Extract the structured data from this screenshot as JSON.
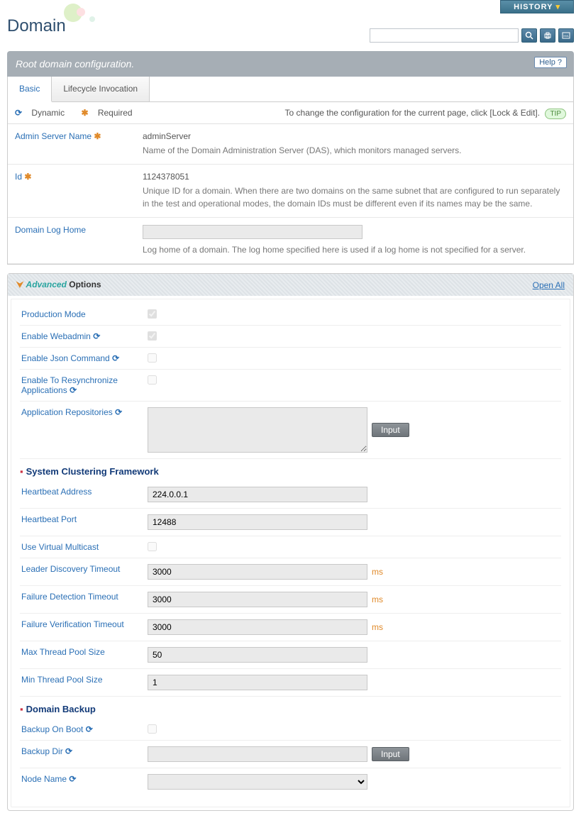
{
  "header": {
    "history_label": "HISTORY",
    "page_title": "Domain",
    "search_placeholder": ""
  },
  "banner": {
    "subtitle": "Root domain configuration.",
    "help_label": "Help"
  },
  "tabs": [
    {
      "label": "Basic",
      "active": true
    },
    {
      "label": "Lifecycle Invocation",
      "active": false
    }
  ],
  "legend": {
    "dynamic": "Dynamic",
    "required": "Required",
    "hint": "To change the configuration for the current page, click [Lock & Edit].",
    "tip": "TIP"
  },
  "basic_fields": {
    "admin_server_name": {
      "label": "Admin Server Name",
      "value": "adminServer",
      "desc": "Name of the Domain Administration Server (DAS), which monitors managed servers."
    },
    "id": {
      "label": "Id",
      "value": "1124378051",
      "desc": "Unique ID for a domain. When there are two domains on the same subnet that are configured to run separately in the test and operational modes, the domain IDs must be different even if its names may be the same."
    },
    "domain_log_home": {
      "label": "Domain Log Home",
      "value": "",
      "desc": "Log home of a domain. The log home specified here is used if a log home is not specified for a server."
    }
  },
  "advanced": {
    "title_adv": "Advanced",
    "title_opt": "Options",
    "open_all": "Open All",
    "input_btn": "Input",
    "fields": {
      "production_mode": {
        "label": "Production Mode",
        "checked": true,
        "dynamic": false
      },
      "enable_webadmin": {
        "label": "Enable Webadmin",
        "checked": true,
        "dynamic": true
      },
      "enable_json_command": {
        "label": "Enable Json Command",
        "checked": false,
        "dynamic": true
      },
      "enable_resync": {
        "label": "Enable To Resynchronize Applications",
        "checked": false,
        "dynamic": true
      },
      "app_repos": {
        "label": "Application Repositories",
        "value": "",
        "dynamic": true
      }
    },
    "sections": {
      "scf": {
        "title": "System Clustering Framework",
        "heartbeat_address": {
          "label": "Heartbeat Address",
          "value": "224.0.0.1"
        },
        "heartbeat_port": {
          "label": "Heartbeat Port",
          "value": "12488"
        },
        "use_virtual_multicast": {
          "label": "Use Virtual Multicast",
          "checked": false
        },
        "leader_discovery_timeout": {
          "label": "Leader Discovery Timeout",
          "value": "3000",
          "unit": "ms"
        },
        "failure_detection_timeout": {
          "label": "Failure Detection Timeout",
          "value": "3000",
          "unit": "ms"
        },
        "failure_verification_timeout": {
          "label": "Failure Verification Timeout",
          "value": "3000",
          "unit": "ms"
        },
        "max_thread_pool": {
          "label": "Max Thread Pool Size",
          "value": "50"
        },
        "min_thread_pool": {
          "label": "Min Thread Pool Size",
          "value": "1"
        }
      },
      "backup": {
        "title": "Domain Backup",
        "backup_on_boot": {
          "label": "Backup On Boot",
          "checked": false,
          "dynamic": true
        },
        "backup_dir": {
          "label": "Backup Dir",
          "value": "",
          "dynamic": true
        },
        "node_name": {
          "label": "Node Name",
          "value": "",
          "dynamic": true
        }
      }
    }
  }
}
